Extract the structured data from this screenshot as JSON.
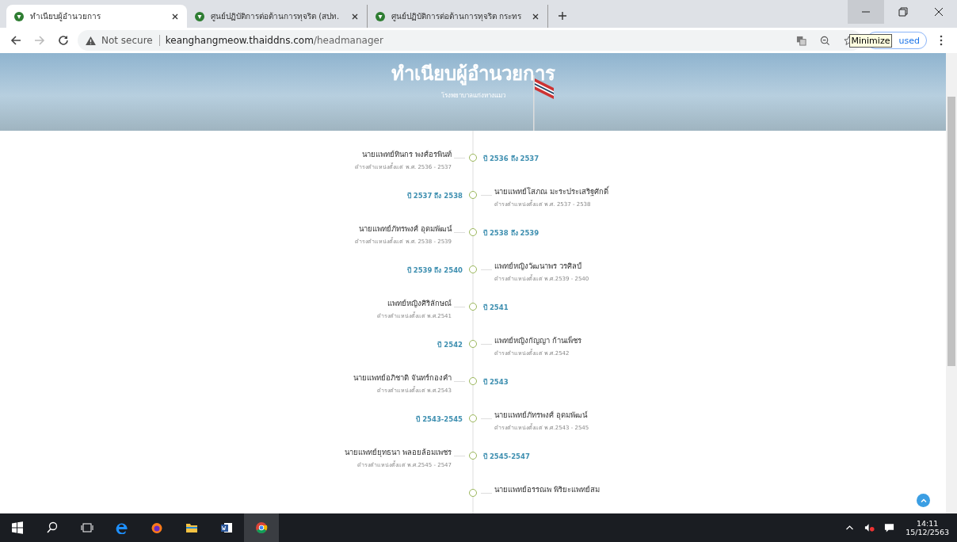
{
  "browser": {
    "tabs": [
      {
        "title": "ทำเนียบผู้อำนวยการ",
        "selected": true
      },
      {
        "title": "ศูนย์ปฏิบัติการต่อต้านการทุจริต (สปท.",
        "selected": false
      },
      {
        "title": "ศูนย์ปฏิบัติการต่อต้านการทุจริต กระทร",
        "selected": false
      }
    ],
    "security": "Not secure",
    "url_host": "keanghangmeow.thaiddns.com",
    "url_path": "/headmanager",
    "profile": "used",
    "tooltip": "Minimize"
  },
  "page": {
    "title": "ทำเนียบผู้อำนวยการ",
    "subtitle": "โรงพยาบาลแก่งหางแมว",
    "timeline": [
      {
        "kind": "left",
        "name": "นายแพทย์ทินกร พงศ์อรพินท์",
        "term": "ดำรงตำแหน่งตั้งแต่ พ.ศ. 2536 - 2537",
        "period": "ปี 2536 ถึง 2537"
      },
      {
        "kind": "right",
        "name": "นายแพทย์โสภณ มะระประเสริฐศักดิ์",
        "term": "ดำรงตำแหน่งตั้งแต่ พ.ศ. 2537 - 2538",
        "period": "ปี 2537 ถึง 2538"
      },
      {
        "kind": "left",
        "name": "นายแพทย์ภัทรพงศ์ อุดมพัฒน์",
        "term": "ดำรงตำแหน่งตั้งแต่ พ.ศ. 2538 - 2539",
        "period": "ปี 2538 ถึง 2539"
      },
      {
        "kind": "right",
        "name": "แพทย์หญิงวัฒนาพร วรศิลป์",
        "term": "ดำรงตำแหน่งตั้งแต่ พ.ศ.2539 - 2540",
        "period": "ปี 2539 ถึง 2540"
      },
      {
        "kind": "left",
        "name": "แพทย์หญิงศิริลักษณ์",
        "term": "ดำรงตำแหน่งตั้งแต่ พ.ศ.2541",
        "period": "ปี 2541"
      },
      {
        "kind": "right",
        "name": "แพทย์หญิงกัญญา ก้านเพ็ชร",
        "term": "ดำรงตำแหน่งตั้งแต่ พ.ศ.2542",
        "period": "ปี 2542"
      },
      {
        "kind": "left",
        "name": "นายแพทย์อภิชาติ จันทร์กองคำ",
        "term": "ดำรงตำแหน่งตั้งแต่ พ.ศ.2543",
        "period": "ปี 2543"
      },
      {
        "kind": "right",
        "name": "นายแพทย์ภัทรพงศ์ อุดมพัฒน์",
        "term": "ดำรงตำแหน่งตั้งแต่ พ.ศ.2543 - 2545",
        "period": "ปี 2543-2545"
      },
      {
        "kind": "left",
        "name": "นายแพทย์ยุทธนา พลอยล้อมเพชร",
        "term": "ดำรงตำแหน่งตั้งแต่ พ.ศ.2545 - 2547",
        "period": "ปี 2545-2547"
      },
      {
        "kind": "right",
        "name": "นายแพทย์อรรณพ พิริยะแพทย์สม"
      }
    ]
  },
  "taskbar": {
    "time": "14:11",
    "date": "15/12/2563"
  }
}
